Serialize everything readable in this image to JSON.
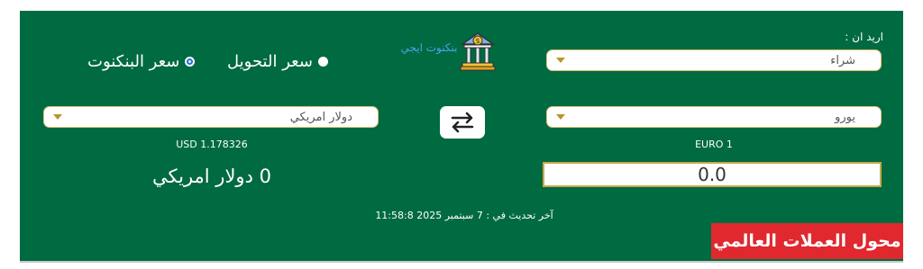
{
  "want_label": "اريد ان :",
  "operation": {
    "value": "شراء",
    "options": [
      "شراء"
    ]
  },
  "brand": {
    "name": "بنكنوت ايجي",
    "icon": "bank-icon"
  },
  "rate_type": {
    "options": [
      {
        "label": "سعر التحويل",
        "selected": false
      },
      {
        "label": "سعر البنكنوت",
        "selected": true
      }
    ]
  },
  "from_currency": {
    "value": "يورو",
    "rate": "EURO 1"
  },
  "to_currency": {
    "value": "دولار امريكي",
    "rate": "USD 1.178326"
  },
  "swap": {
    "icon": "swap-arrows-icon"
  },
  "amount": {
    "value": "0.0"
  },
  "result": {
    "text": "0 دولار امريكي"
  },
  "last_update": {
    "text": "آخر تحديث في : 7 سبتمبر 2025 11:58:8"
  },
  "badge": {
    "text": "محول العملات العالمي"
  },
  "colors": {
    "panel": "#006a41",
    "badge": "#e0282e",
    "accent": "#b8962e"
  }
}
